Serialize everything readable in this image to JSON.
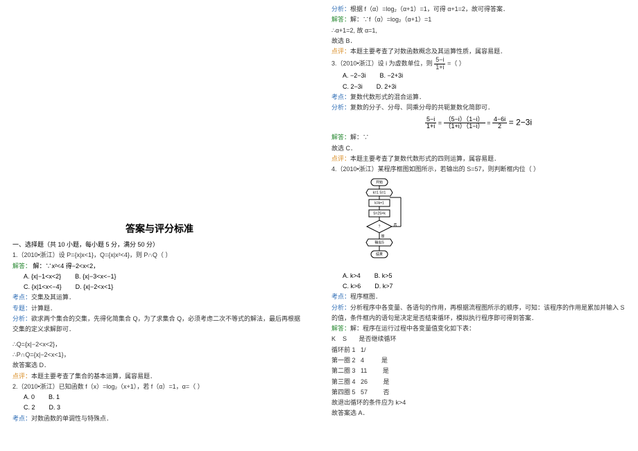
{
  "page_title": "答案与评分标准",
  "section1": {
    "header": "一、选择题（共 10 小题，每小题 5 分，满分 50 分）"
  },
  "q1": {
    "stem": "1.（2010•浙江）设 P={x|x<1}，Q={x|x²<4}，则 P∩Q（    ）",
    "optA": "A. {x|−1<x<2}",
    "optB": "B. {x|−3<x<−1}",
    "optC": "C. {x|1<x<−4}",
    "optD": "D. {x|−2<x<1}",
    "answer_label": "解答：",
    "answer": "解：∵x²<4 得−2<x<2，",
    "kaodian_label": "考点：",
    "kaodian": "交集及其运算．",
    "zhuanti_label": "专题：",
    "zhuanti": "计算题．",
    "fenxi_label": "分析：",
    "fenxi": "欲求两个集合的交集，先得化简集合 Q，为了求集合 Q，必须考虑二次不等式的解法，最后再根据交集的定义求解即可．",
    "step2": "∴Q={x|−2<x<2}，",
    "step3": "∴P∩Q={x|−2<x<1}，",
    "step4": "故答案选 D．",
    "dianping_label": "点评：",
    "dianping": "本题主要考查了集合的基本运算，属容易题．"
  },
  "q2": {
    "stem": "2.（2010•浙江）已知函数 f（x）=log₂（x+1），若 f（α）=1，α=（    ）",
    "optA": "A. 0",
    "optB": "B. 1",
    "optC": "C. 2",
    "optD": "D. 3",
    "kaodian_label": "考点：",
    "kaodian": "对数函数的单调性与特殊点．",
    "fenxi_label": "分析：",
    "fenxi": "根据 f（α）=log₂（α+1）=1，可得 α+1=2，故可得答案．",
    "answer_label": "解答：",
    "answer": "解：∵f（α）=log₂（α+1）=1",
    "step2": "∴α+1=2, 故 α=1,",
    "step3": "故选 B．",
    "dianping_label": "点评：",
    "dianping": "本题主要考查了对数函数概念及其运算性质，属容易题．"
  },
  "q3": {
    "stem_a": "3.（2010•浙江）设 i 为虚数单位，则",
    "frac_num": "5−i",
    "frac_den": "1+i",
    "stem_b": "=（    ）",
    "optA": "A. −2−3i",
    "optB": "B. −2+3i",
    "optC": "C. 2−3i",
    "optD": "D. 2+3i",
    "kaodian_label": "考点：",
    "kaodian": "复数代数形式的混合运算．",
    "fenxi_label": "分析：",
    "fenxi": "复数的分子、分母、同乘分母的共轭复数化简即可．",
    "answer_label": "解答：",
    "answer": "解：∵",
    "eq_n1": "5−i",
    "eq_d1": "1+i",
    "eq_n2": "（5−i）（1−i）",
    "eq_d2": "（1+i）（1−i）",
    "eq_n3": "4−6i",
    "eq_d3": "2",
    "eq_res": "= 2−3i",
    "step2": "故选 C．",
    "dianping_label": "点评：",
    "dianping": "本题主要考查了复数代数形式的四则运算，属容易题．"
  },
  "q4": {
    "stem": "4.（2010•浙江）某程序框图如图所示，若输出的 S=57，则判断框内位（    ）",
    "fc": {
      "start": "开始",
      "b1": "k=1 S=1",
      "b2": "k=k+1",
      "b3": "S=2S+k",
      "cond": "?",
      "yes": "是",
      "no": "否",
      "out": "输出S",
      "end": "结束"
    },
    "optA": "A. k>4",
    "optB": "B. k>5",
    "optC": "C. k>6",
    "optD": "D. k>7",
    "kaodian_label": "考点：",
    "kaodian": "程序框图．",
    "fenxi_label": "分析：",
    "fenxi": "分析程序中各变量、各语句的作用，再根据流程图所示的顺序，可知：该程序的作用是累加并输入 S 的值，条件框内的语句是决定是否结束循环，模拟执行程序即可得到答案．",
    "answer_label": "解答：",
    "answer": "解：程序在运行过程中各变量值变化如下表：",
    "tab_h1": "K    S       是否继续循环",
    "tab_r0": "循环前 1   1/",
    "tab_r1": "第一圈 2   4          是",
    "tab_r2": "第二圈 3   11         是",
    "tab_r3": "第三圈 4   26         是",
    "tab_r4": "第四圈 5   57         否",
    "step2": "故退出循环的条件应为 k>4",
    "step3": "故答案选 A．"
  }
}
